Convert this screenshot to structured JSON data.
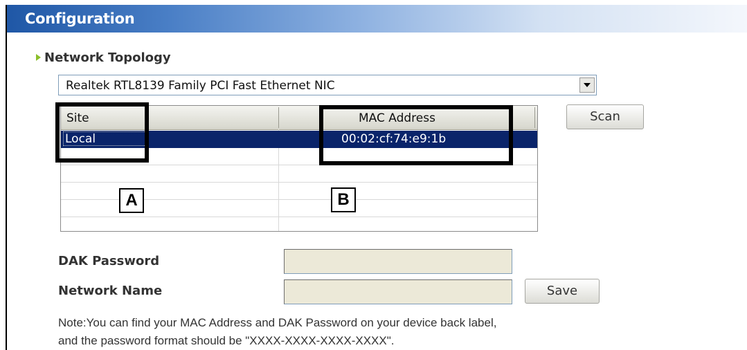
{
  "panel": {
    "title": "Configuration"
  },
  "network_topology": {
    "section_title": "Network Topology",
    "adapter_selected": "Realtek RTL8139 Family PCI Fast Ethernet NIC"
  },
  "device_table": {
    "columns": [
      "Site",
      "MAC Address"
    ],
    "rows": [
      {
        "site": "Local",
        "mac": "00:02:cf:74:e9:1b",
        "selected": true
      }
    ]
  },
  "buttons": {
    "scan": "Scan",
    "save": "Save"
  },
  "fields": {
    "dak_password": {
      "label": "DAK Password",
      "value": ""
    },
    "network_name": {
      "label": "Network Name",
      "value": ""
    }
  },
  "note": {
    "line1": "Note:You can find your MAC Address and DAK Password on your device back label,",
    "line2": "and the password format should be \"XXXX-XXXX-XXXX-XXXX\"."
  },
  "callouts": {
    "a": "A",
    "b": "B"
  },
  "colors": {
    "header_blue": "#1f57a6",
    "selection_blue": "#0a246a",
    "bullet_green": "#8bbf2a"
  }
}
